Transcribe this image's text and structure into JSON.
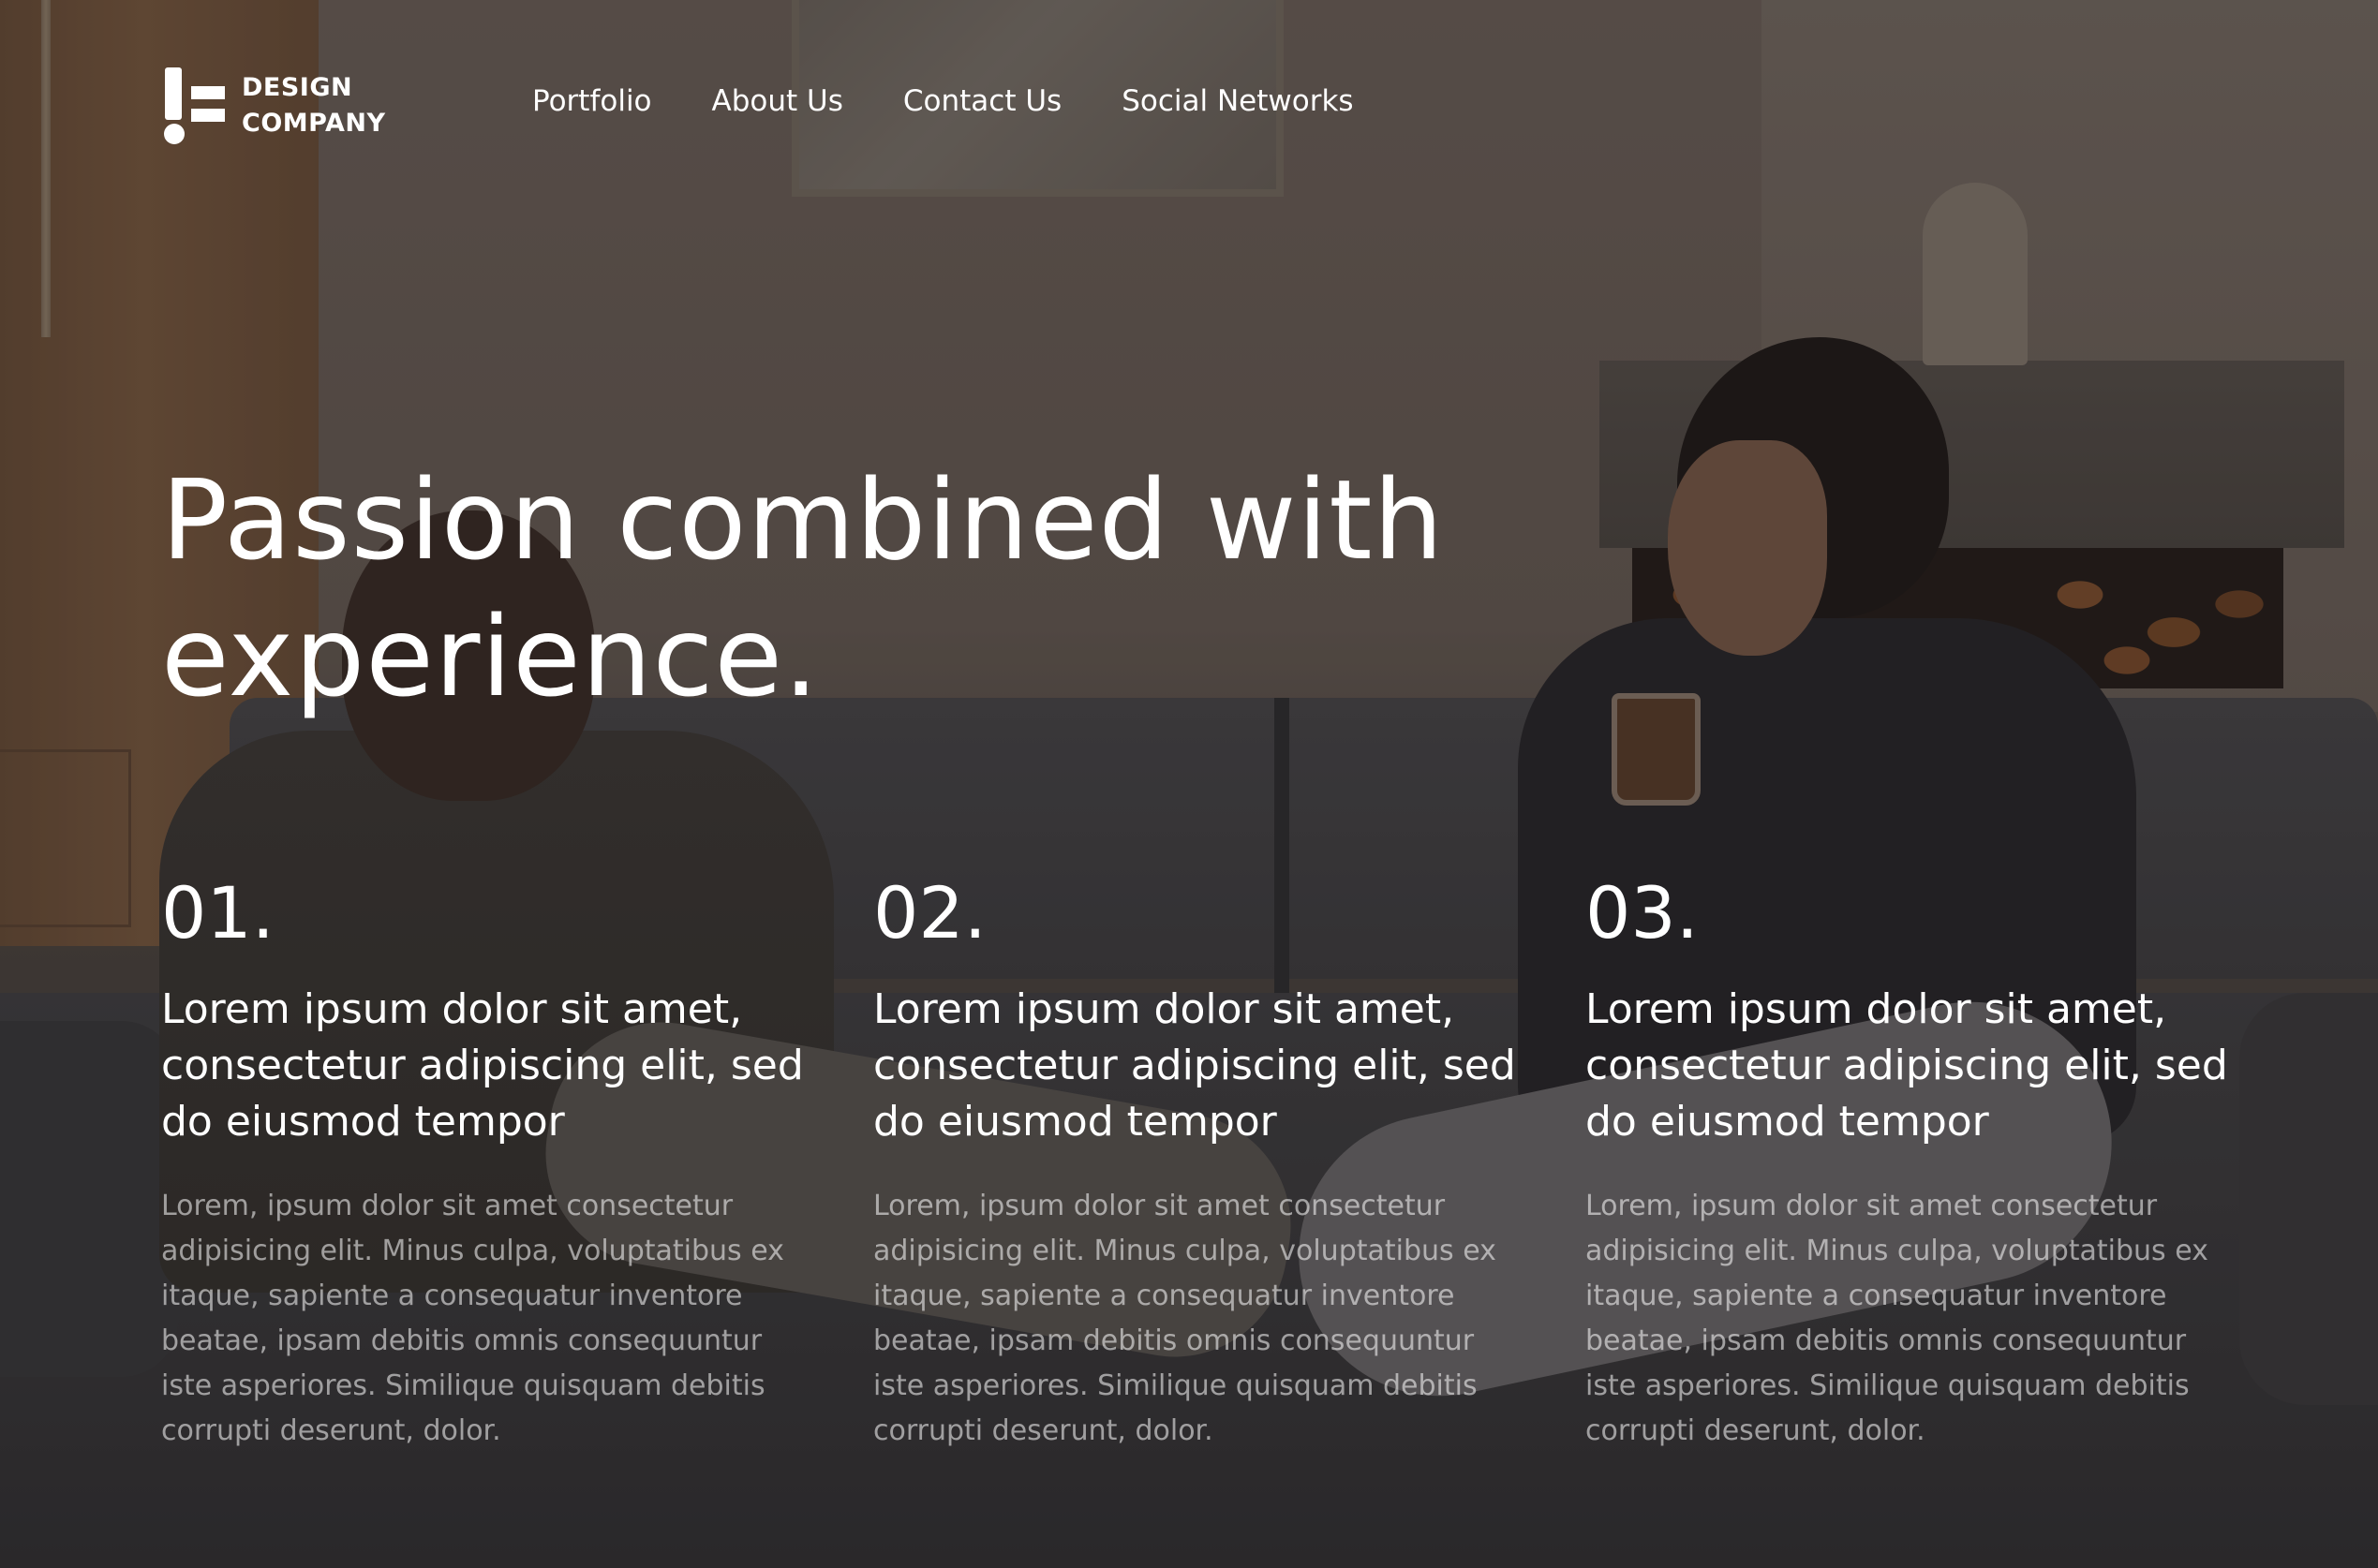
{
  "brand": {
    "line1": "DESIGN",
    "line2": "COMPANY"
  },
  "nav": {
    "items": [
      {
        "label": "Portfolio"
      },
      {
        "label": "About Us"
      },
      {
        "label": "Contact Us"
      },
      {
        "label": "Social Networks"
      }
    ]
  },
  "hero": {
    "title_line1": "Passion combined with",
    "title_line2": "experience."
  },
  "features": [
    {
      "number": "01.",
      "heading": "Lorem ipsum dolor sit amet, consectetur adipiscing elit, sed do eiusmod tempor",
      "text": "Lorem, ipsum dolor sit amet consectetur adipisicing elit. Minus culpa, voluptatibus ex itaque, sapiente a consequatur inventore beatae, ipsam debitis omnis consequuntur iste asperiores. Similique quisquam debitis corrupti deserunt, dolor."
    },
    {
      "number": "02.",
      "heading": "Lorem ipsum dolor sit amet, consectetur adipiscing elit, sed do eiusmod tempor",
      "text": "Lorem, ipsum dolor sit amet consectetur adipisicing elit. Minus culpa, voluptatibus ex itaque, sapiente a consequatur inventore beatae, ipsam debitis omnis consequuntur iste asperiores. Similique quisquam debitis corrupti deserunt, dolor."
    },
    {
      "number": "03.",
      "heading": "Lorem ipsum dolor sit amet, consectetur adipiscing elit, sed do eiusmod tempor",
      "text": "Lorem, ipsum dolor sit amet consectetur adipisicing elit. Minus culpa, voluptatibus ex itaque, sapiente a consequatur inventore beatae, ipsam debitis omnis consequuntur iste asperiores. Similique quisquam debitis corrupti deserunt, dolor."
    }
  ],
  "colors": {
    "text": "#ffffff",
    "muted_text": "#9c9794",
    "overlay": "#141211"
  }
}
